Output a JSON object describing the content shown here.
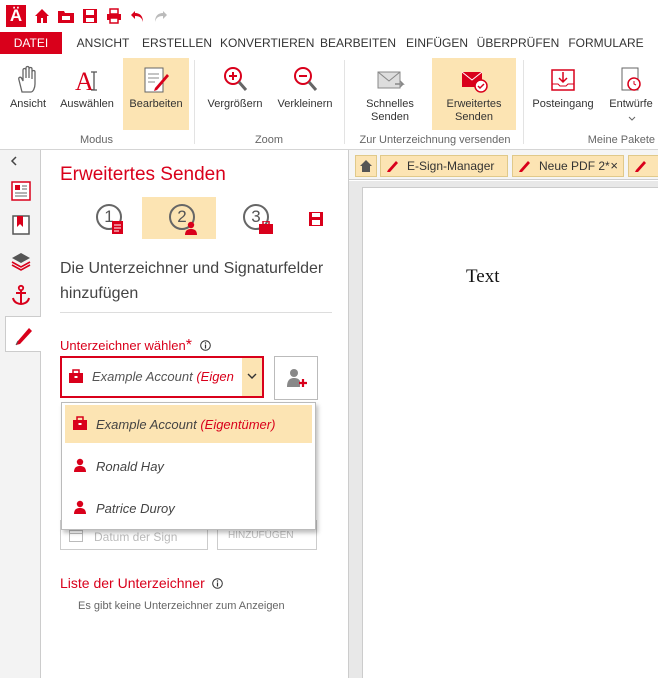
{
  "quick_access": {
    "logo": "Ä",
    "icons": [
      "home-icon",
      "folder-icon",
      "save-icon",
      "print-icon",
      "undo-icon",
      "redo-icon"
    ]
  },
  "menu": {
    "tabs": [
      "DATEI",
      "ANSICHT",
      "ERSTELLEN",
      "KONVERTIEREN",
      "BEARBEITEN",
      "EINFÜGEN",
      "ÜBERPRÜFEN",
      "FORMULARE"
    ],
    "active": "DATEI"
  },
  "ribbon": {
    "buttons": {
      "ansicht": "Ansicht",
      "auswaehlen": "Auswählen",
      "bearbeiten": "Bearbeiten",
      "vergroessern": "Vergrößern",
      "verkleinern": "Verkleinern",
      "schnelles_senden_1": "Schnelles",
      "schnelles_senden_2": "Senden",
      "erweitertes_senden_1": "Erweitertes",
      "erweitertes_senden_2": "Senden",
      "posteingang": "Posteingang",
      "entwuerfe": "Entwürfe"
    },
    "groups": {
      "modus": "Modus",
      "zoom": "Zoom",
      "zur_unterzeichnung": "Zur Unterzeichnung versenden",
      "meine_pakete": "Meine Pakete"
    },
    "accent": "#d9001b",
    "selected_bg": "#fce4b3"
  },
  "panel": {
    "title": "Erweitertes Senden",
    "steps": [
      "1",
      "2",
      "3"
    ],
    "active_step": "2",
    "description": "Die Unterzeichner und Signaturfelder hinzufügen",
    "signer_label": "Unterzeichner wählen",
    "required_mark": "*",
    "info_icon": "info-icon",
    "combo_value_name": "Example Account",
    "combo_value_role": "(Eigen",
    "ghost_field_text": "Datum der Sign",
    "ghost_button_text": "HINZUFÜGEN",
    "list_label": "Liste der Unterzeichner",
    "list_empty": "Es gibt keine Unterzeichner zum Anzeigen"
  },
  "dropdown": {
    "options": [
      {
        "name": "Example Account",
        "role": "(Eigentümer)",
        "icon": "briefcase-icon",
        "selected": true
      },
      {
        "name": "Ronald Hay",
        "role": "",
        "icon": "person-icon",
        "selected": false
      },
      {
        "name": "Patrice Duroy",
        "role": "",
        "icon": "person-icon",
        "selected": false
      }
    ]
  },
  "doc_tabs": {
    "tabs": [
      "E-Sign-Manager",
      "Neue PDF 2*"
    ],
    "close_glyph": "×"
  },
  "document": {
    "text": "Text"
  }
}
